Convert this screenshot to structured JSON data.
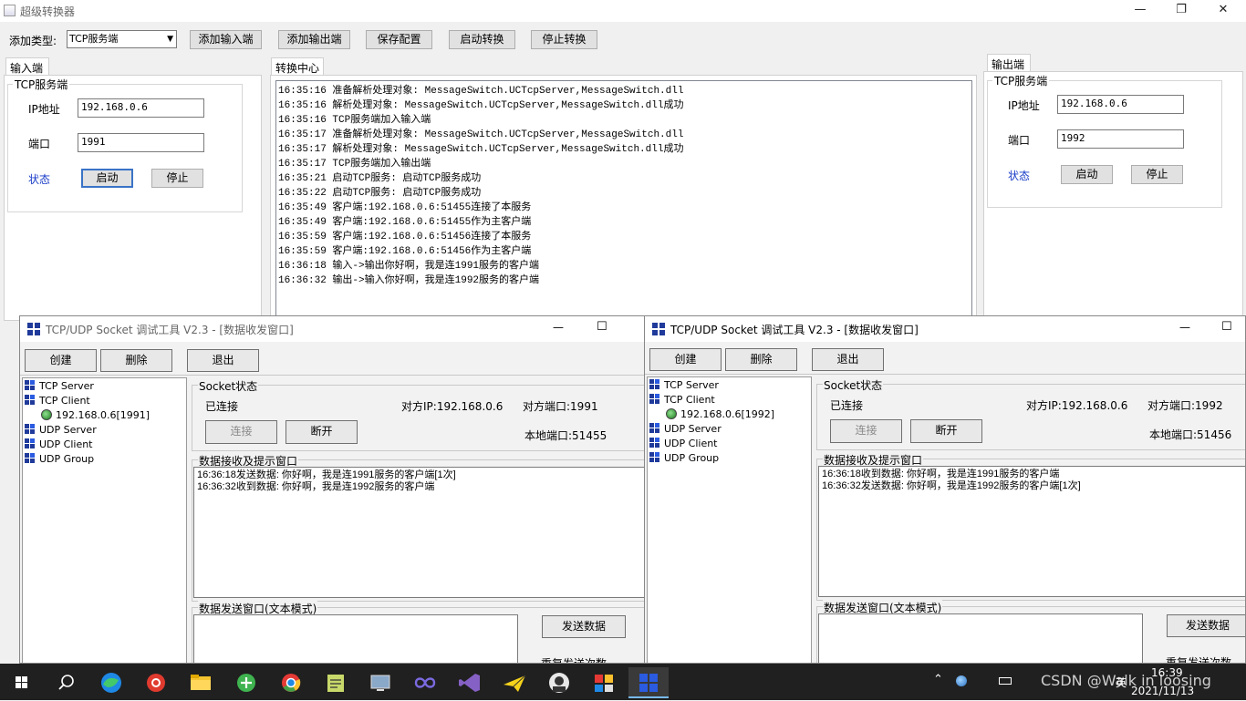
{
  "main": {
    "title": "超级转换器",
    "caption": {
      "minimize": "—",
      "restore": "❐",
      "close": "✕"
    },
    "toolbar": {
      "type_label": "添加类型:",
      "type_value": "TCP服务端",
      "add_input": "添加输入端",
      "add_output": "添加输出端",
      "save_config": "保存配置",
      "start_convert": "启动转换",
      "stop_convert": "停止转换"
    },
    "input_panel": {
      "tab": "输入端",
      "group": "TCP服务端",
      "ip_label": "IP地址",
      "ip_value": "192.168.0.6",
      "port_label": "端口",
      "port_value": "1991",
      "status_label": "状态",
      "start": "启动",
      "stop": "停止"
    },
    "center": {
      "tab": "转换中心",
      "log": [
        "16:35:16 准备解析处理对象: MessageSwitch.UCTcpServer,MessageSwitch.dll",
        "16:35:16 解析处理对象: MessageSwitch.UCTcpServer,MessageSwitch.dll成功",
        "16:35:16 TCP服务端加入输入端",
        "16:35:17 准备解析处理对象: MessageSwitch.UCTcpServer,MessageSwitch.dll",
        "16:35:17 解析处理对象: MessageSwitch.UCTcpServer,MessageSwitch.dll成功",
        "16:35:17 TCP服务端加入输出端",
        "16:35:21 启动TCP服务: 启动TCP服务成功",
        "16:35:22 启动TCP服务: 启动TCP服务成功",
        "16:35:49 客户端:192.168.0.6:51455连接了本服务",
        "16:35:49 客户端:192.168.0.6:51455作为主客户端",
        "16:35:59 客户端:192.168.0.6:51456连接了本服务",
        "16:35:59 客户端:192.168.0.6:51456作为主客户端",
        "16:36:18 输入->输出你好啊，我是连1991服务的客户端",
        "16:36:32 输出->输入你好啊，我是连1992服务的客户端"
      ]
    },
    "output_panel": {
      "tab": "输出端",
      "group": "TCP服务端",
      "ip_label": "IP地址",
      "ip_value": "192.168.0.6",
      "port_label": "端口",
      "port_value": "1992",
      "status_label": "状态",
      "start": "启动",
      "stop": "停止"
    }
  },
  "socket_left": {
    "title": "TCP/UDP Socket 调试工具 V2.3 - [数据收发窗口]",
    "caption": {
      "minimize": "—",
      "maximize": "☐"
    },
    "buttons": {
      "create": "创建",
      "delete": "删除",
      "exit": "退出"
    },
    "tree": {
      "tcp_server": "TCP Server",
      "tcp_client": "TCP Client",
      "client_node": "192.168.0.6[1991]",
      "udp_server": "UDP Server",
      "udp_client": "UDP Client",
      "udp_group": "UDP Group"
    },
    "socket_status": {
      "caption": "Socket状态",
      "state": "已连接",
      "peer_ip": "对方IP:192.168.0.6",
      "peer_port": "对方端口:1991",
      "connect": "连接",
      "disconnect": "断开",
      "local_port": "本地端口:51455"
    },
    "recv_caption": "数据接收及提示窗口",
    "recv_lines": [
      "16:36:18发送数据: 你好啊，我是连1991服务的客户端[1次]",
      "16:36:32收到数据: 你好啊，我是连1992服务的客户端"
    ],
    "send_caption": "数据发送窗口(文本模式)",
    "send_button": "发送数据",
    "repeat_label": "重复发送次数"
  },
  "socket_right": {
    "title": "TCP/UDP Socket 调试工具 V2.3 - [数据收发窗口]",
    "caption": {
      "minimize": "—",
      "maximize": "☐"
    },
    "buttons": {
      "create": "创建",
      "delete": "删除",
      "exit": "退出"
    },
    "tree": {
      "tcp_server": "TCP Server",
      "tcp_client": "TCP Client",
      "client_node": "192.168.0.6[1992]",
      "udp_server": "UDP Server",
      "udp_client": "UDP Client",
      "udp_group": "UDP Group"
    },
    "socket_status": {
      "caption": "Socket状态",
      "state": "已连接",
      "peer_ip": "对方IP:192.168.0.6",
      "peer_port": "对方端口:1992",
      "connect": "连接",
      "disconnect": "断开",
      "local_port": "本地端口:51456"
    },
    "recv_caption": "数据接收及提示窗口",
    "recv_lines": [
      "16:36:18收到数据: 你好啊，我是连1991服务的客户端",
      "16:36:32发送数据: 你好啊，我是连1992服务的客户端[1次]"
    ],
    "send_caption": "数据发送窗口(文本模式)",
    "send_button": "发送数据",
    "repeat_label": "重复发送次数"
  },
  "taskbar": {
    "time": "16:39",
    "date": "2021/11/13",
    "ime": "英",
    "watermark": "CSDN @Walk in loosing",
    "colors": {
      "bg": "#202020",
      "accent": "#76b9ed"
    },
    "icons": [
      "windows-start-icon",
      "search-icon",
      "edge-icon",
      "netease-music-icon",
      "file-explorer-icon",
      "green-app-icon",
      "chrome-icon",
      "notepad-icon",
      "remote-desktop-icon",
      "infinity-app-icon",
      "visual-studio-icon",
      "paper-plane-icon",
      "avatar-app-icon",
      "tool-app-icon",
      "socket-tool-icon"
    ]
  }
}
